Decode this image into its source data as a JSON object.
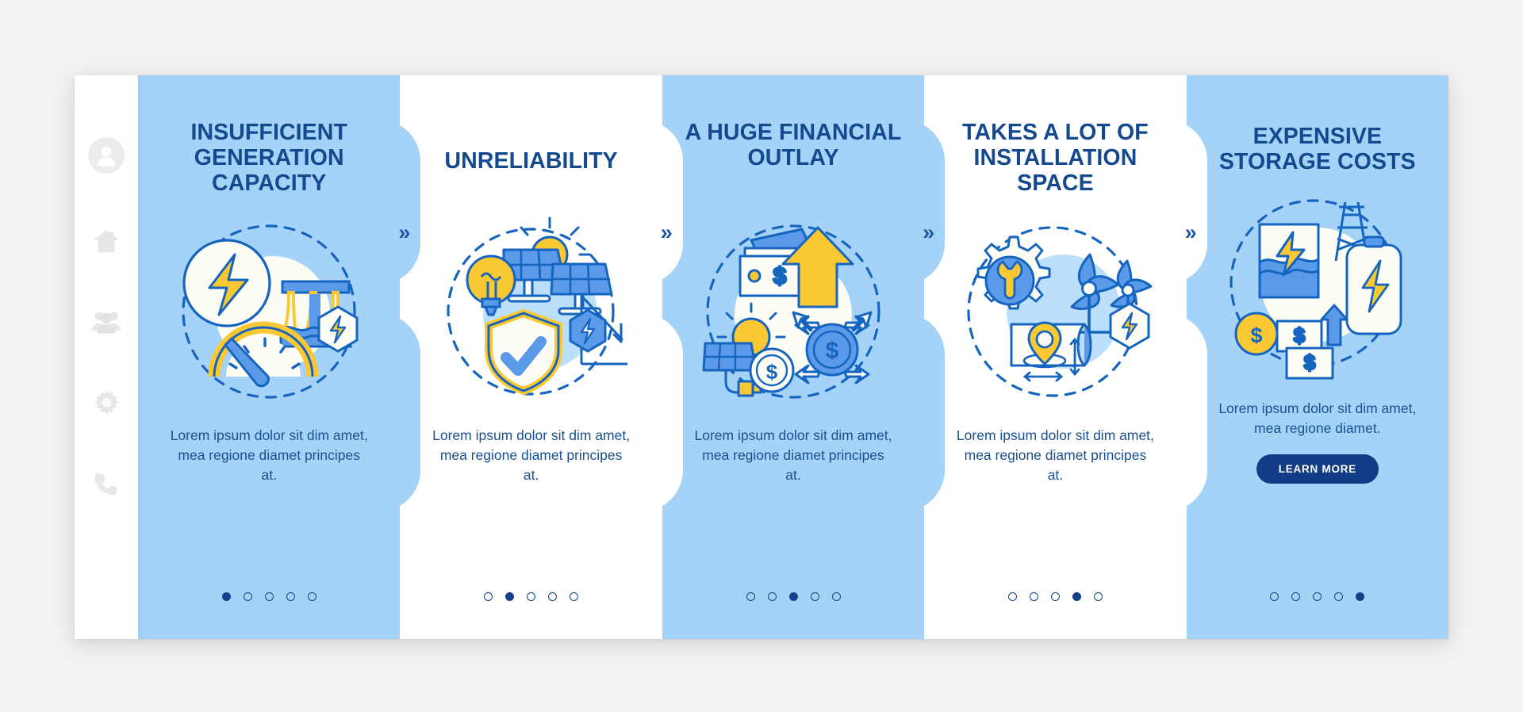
{
  "colors": {
    "page_bg": "#f2f2f2",
    "card_blue": "#a5d3f7",
    "card_white": "#ffffff",
    "title_blue": "#14498f",
    "body_blue": "#19508f",
    "button_navy": "#123c85",
    "accent_yellow": "#fac832",
    "accent_blue": "#4a8fe0",
    "sidebar_icon_grey": "#e3e3e3"
  },
  "sidebar": {
    "items": [
      {
        "name": "avatar-icon",
        "label": "Account"
      },
      {
        "name": "home-icon",
        "label": "Home"
      },
      {
        "name": "users-icon",
        "label": "Users"
      },
      {
        "name": "gear-icon",
        "label": "Settings"
      },
      {
        "name": "phone-icon",
        "label": "Contact"
      }
    ]
  },
  "separator": {
    "glyph": "»",
    "count": 4
  },
  "cards": [
    {
      "index": 1,
      "theme": "blue",
      "title": "INSUFFICIENT GENERATION CAPACITY",
      "body": "Lorem ipsum dolor sit dim amet, mea regione diamet principes at.",
      "illustration": "hydro-power-gauge-illustration",
      "dots": {
        "total": 5,
        "active": 1
      },
      "button": null
    },
    {
      "index": 2,
      "theme": "white",
      "title": "UNRELIABILITY",
      "body": "Lorem ipsum dolor sit dim amet, mea regione diamet principes at.",
      "illustration": "solar-panel-shield-illustration",
      "dots": {
        "total": 5,
        "active": 2
      },
      "button": null
    },
    {
      "index": 3,
      "theme": "blue",
      "title": "A HUGE FINANCIAL OUTLAY",
      "body": "Lorem ipsum dolor sit dim amet, mea regione diamet principes at.",
      "illustration": "money-cost-illustration",
      "dots": {
        "total": 5,
        "active": 3
      },
      "button": null
    },
    {
      "index": 4,
      "theme": "white",
      "title": "TAKES A LOT OF INSTALLATION SPACE",
      "body": "Lorem ipsum dolor sit dim amet, mea regione diamet principes at.",
      "illustration": "wind-turbine-blueprint-illustration",
      "dots": {
        "total": 5,
        "active": 4
      },
      "button": null
    },
    {
      "index": 5,
      "theme": "blue",
      "title": "EXPENSIVE STORAGE COSTS",
      "body": "Lorem ipsum dolor sit dim amet, mea regione diamet.",
      "illustration": "battery-storage-cost-illustration",
      "dots": {
        "total": 5,
        "active": 5
      },
      "button": {
        "label": "LEARN MORE"
      }
    }
  ]
}
